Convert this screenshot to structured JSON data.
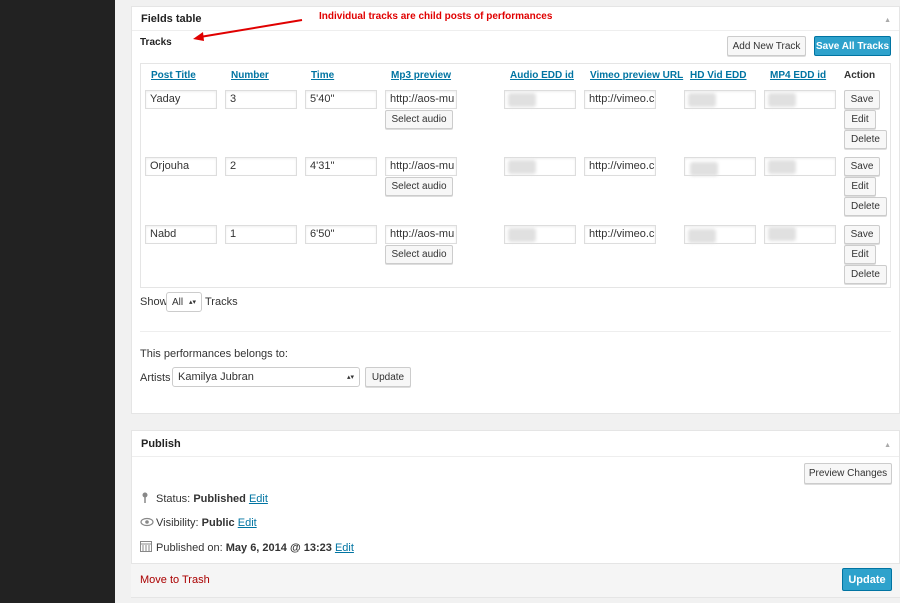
{
  "annotation": "Individual tracks are child posts of performances",
  "fields_panel": {
    "title": "Fields table",
    "section": "Tracks",
    "add_new_track": "Add New Track",
    "save_all_tracks": "Save All Tracks",
    "columns": [
      "Post Title",
      "Number",
      "Time",
      "Mp3 preview",
      "Audio EDD id",
      "Vimeo preview URL",
      "HD Vid EDD",
      "MP4 EDD id",
      "Action"
    ],
    "rows": [
      {
        "title": "Yaday",
        "number": "3",
        "time": "5'40\"",
        "mp3": "http://aos-mu",
        "vimeo": "http://vimeo.c"
      },
      {
        "title": "Orjouha",
        "number": "2",
        "time": "4'31\"",
        "mp3": "http://aos-mu",
        "vimeo": "http://vimeo.c"
      },
      {
        "title": "Nabd",
        "number": "1",
        "time": "6'50\"",
        "mp3": "http://aos-mu",
        "vimeo": "http://vimeo.c"
      }
    ],
    "select_audio": "Select audio",
    "save": "Save",
    "edit": "Edit",
    "delete": "Delete",
    "show_label": "Show",
    "show_value": "All",
    "show_suffix": "Tracks",
    "belongs_label": "This performances belongs to:",
    "artists_label": "Artists",
    "artist_value": "Kamilya Jubran",
    "update": "Update"
  },
  "publish_panel": {
    "title": "Publish",
    "preview_changes": "Preview Changes",
    "status_label": "Status:",
    "status_value": "Published",
    "visibility_label": "Visibility:",
    "visibility_value": "Public",
    "published_label": "Published on:",
    "published_value": "May 6, 2014 @ 13:23",
    "edit": "Edit",
    "move_to_trash": "Move to Trash",
    "update": "Update"
  },
  "colors": {
    "primary": "#2ea2cc",
    "link": "#0074a2",
    "trash": "#a00",
    "annotation": "#e00000"
  }
}
